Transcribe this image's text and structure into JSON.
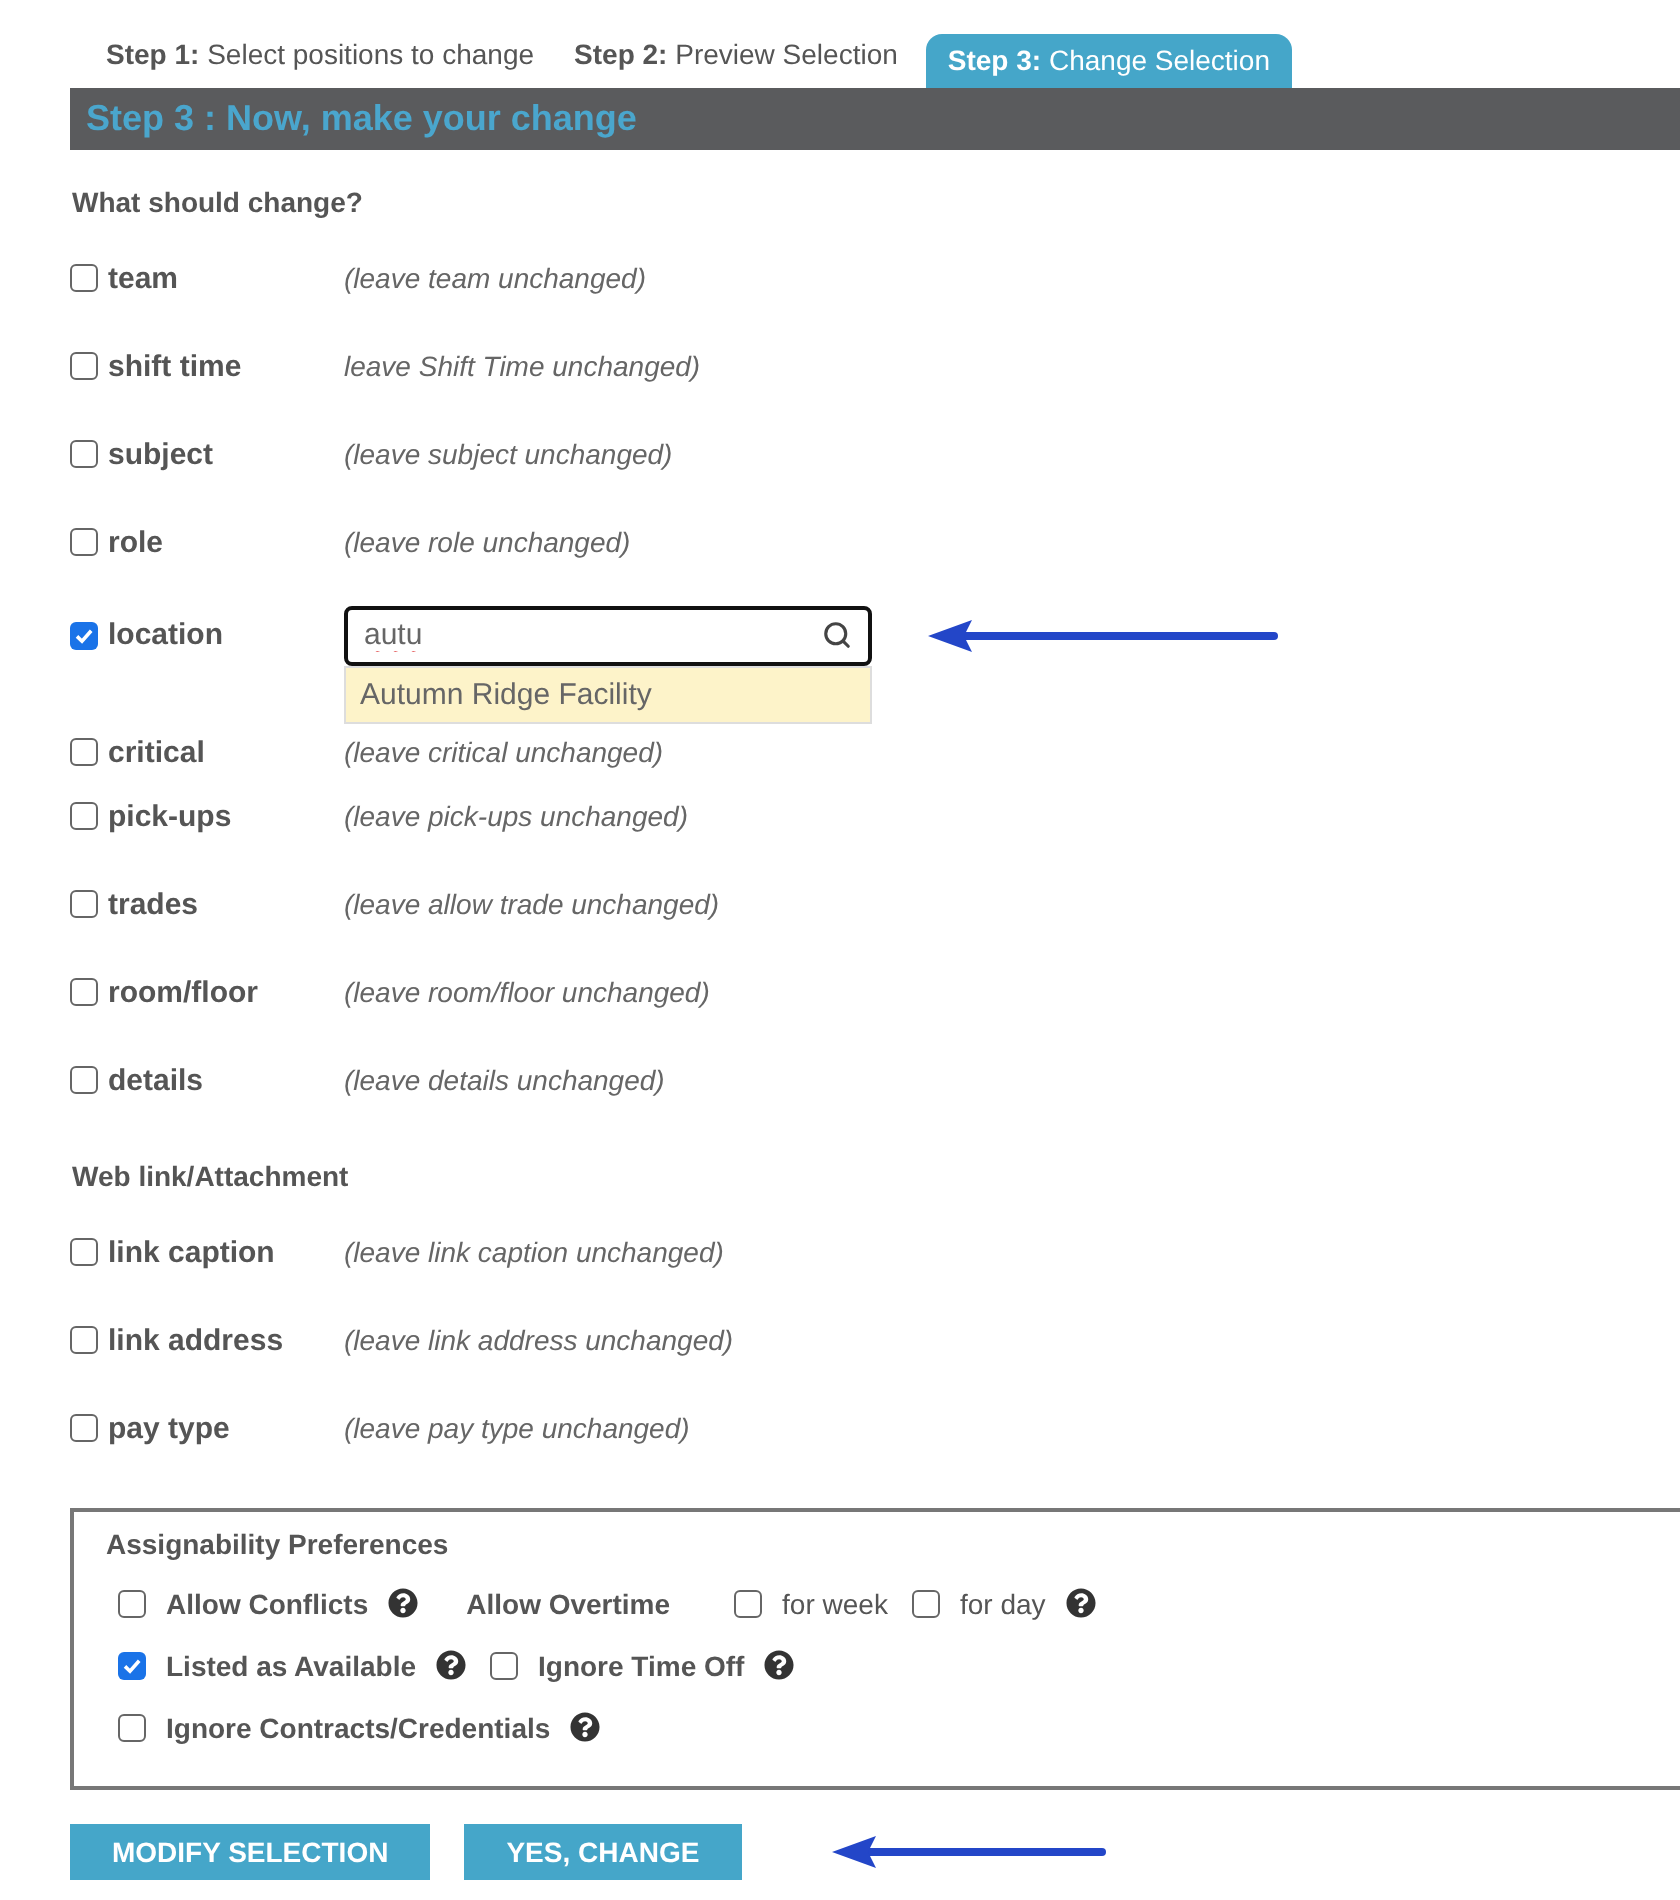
{
  "tabs": [
    {
      "prefix": "Step 1:",
      "label": "Select positions to change",
      "selected": false
    },
    {
      "prefix": "Step 2:",
      "label": "Preview Selection",
      "selected": false
    },
    {
      "prefix": "Step 3:",
      "label": "Change Selection",
      "selected": true
    }
  ],
  "header": "Step 3 : Now, make your change",
  "sections": [
    {
      "title": "What should change?",
      "fields": [
        {
          "kind": "plain",
          "label": "team",
          "checked": false,
          "hint": "(leave team unchanged)"
        },
        {
          "kind": "plain",
          "label": "shift time",
          "checked": false,
          "hint": "leave Shift Time unchanged)"
        },
        {
          "kind": "plain",
          "label": "subject",
          "checked": false,
          "hint": "(leave subject unchanged)"
        },
        {
          "kind": "plain",
          "label": "role",
          "checked": false,
          "hint": "(leave role unchanged)"
        },
        {
          "kind": "search",
          "label": "location",
          "checked": true,
          "value": "autu",
          "suggestions": [
            "Autumn Ridge Facility"
          ]
        },
        {
          "kind": "plain",
          "label": "critical",
          "checked": false,
          "hint": "(leave critical unchanged)"
        },
        {
          "kind": "plain",
          "label": "pick-ups",
          "checked": false,
          "hint": "(leave pick-ups unchanged)"
        },
        {
          "kind": "plain",
          "label": "trades",
          "checked": false,
          "hint": "(leave allow trade unchanged)"
        },
        {
          "kind": "plain",
          "label": "room/floor",
          "checked": false,
          "hint": "(leave room/floor unchanged)"
        },
        {
          "kind": "plain",
          "label": "details",
          "checked": false,
          "hint": "(leave details unchanged)"
        }
      ]
    },
    {
      "title": "Web link/Attachment",
      "fields": [
        {
          "kind": "plain",
          "label": "link caption",
          "checked": false,
          "hint": "(leave link caption unchanged)"
        },
        {
          "kind": "plain",
          "label": "link address",
          "checked": false,
          "hint": "(leave link address unchanged)"
        },
        {
          "kind": "plain",
          "label": "pay type",
          "checked": false,
          "hint": "(leave pay type unchanged)"
        }
      ]
    }
  ],
  "preferences": {
    "title": "Assignability Preferences",
    "rows": [
      [
        {
          "kind": "checkbox",
          "label": "Allow Conflicts",
          "checked": false,
          "help": true
        },
        {
          "kind": "label",
          "label": "Allow Overtime"
        },
        {
          "kind": "checkbox",
          "label": "for week",
          "checked": false,
          "help": false,
          "light": true
        },
        {
          "kind": "checkbox",
          "label": "for day",
          "checked": false,
          "help": true,
          "light": true
        }
      ],
      [
        {
          "kind": "checkbox",
          "label": "Listed as Available",
          "checked": true,
          "help": true
        },
        {
          "kind": "checkbox",
          "label": "Ignore Time Off",
          "checked": false,
          "help": true
        }
      ],
      [
        {
          "kind": "checkbox",
          "label": "Ignore Contracts/Credentials",
          "checked": false,
          "help": true
        }
      ]
    ]
  },
  "buttons": [
    "MODIFY SELECTION",
    "YES, CHANGE"
  ]
}
